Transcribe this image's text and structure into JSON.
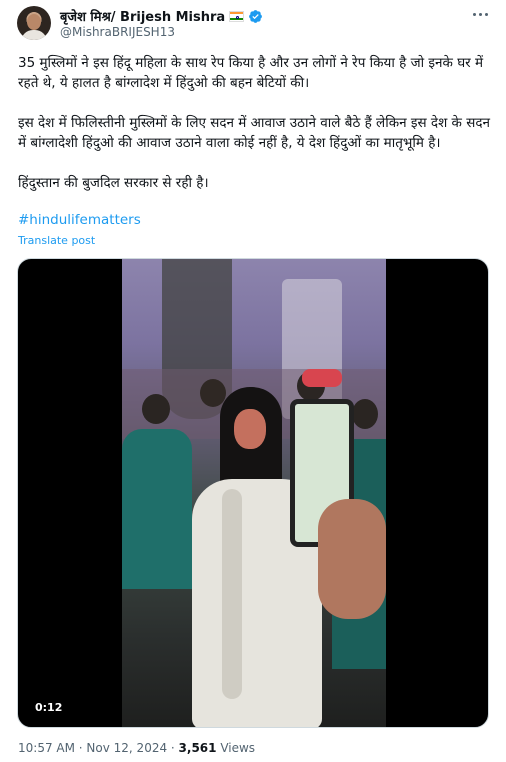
{
  "author": {
    "name": "बृजेश मिश्र/ Brijesh Mishra",
    "handle": "@MishraBRIJESH13",
    "flag_icon": "india-flag",
    "verified_icon": "verified-badge-icon",
    "verified_color": "#1d9bf0"
  },
  "post": {
    "paragraphs": [
      "35 मुस्लिमों ने इस हिंदू महिला के साथ रेप  किया है और उन लोगों ने रेप किया है जो इनके घर में रहते थे, ये हालत है बांग्लादेश में हिंदुओ की बहन बेटियों की।",
      "इस देश में फिलिस्तीनी मुस्लिमों के लिए सदन में आवाज उठाने वाले बैठे हैं लेकिन इस देश के सदन में बांग्लादेशी हिंदुओ की आवाज उठाने वाला कोई नहीं है, ये देश हिंदुओं का मातृभूमि है।",
      "हिंदुस्तान की बुजदिल सरकार से रही है।"
    ],
    "hashtag": "#hindulifematters",
    "translate_label": "Translate post"
  },
  "media": {
    "duration": "0:12"
  },
  "meta": {
    "time": "10:57 AM",
    "separator1": " · ",
    "date": "Nov 12, 2024",
    "separator2": " · ",
    "views_count": "3,561",
    "views_label": " Views"
  },
  "colors": {
    "link": "#1d9bf0",
    "secondary_text": "#536471",
    "primary_text": "#0f1419"
  }
}
